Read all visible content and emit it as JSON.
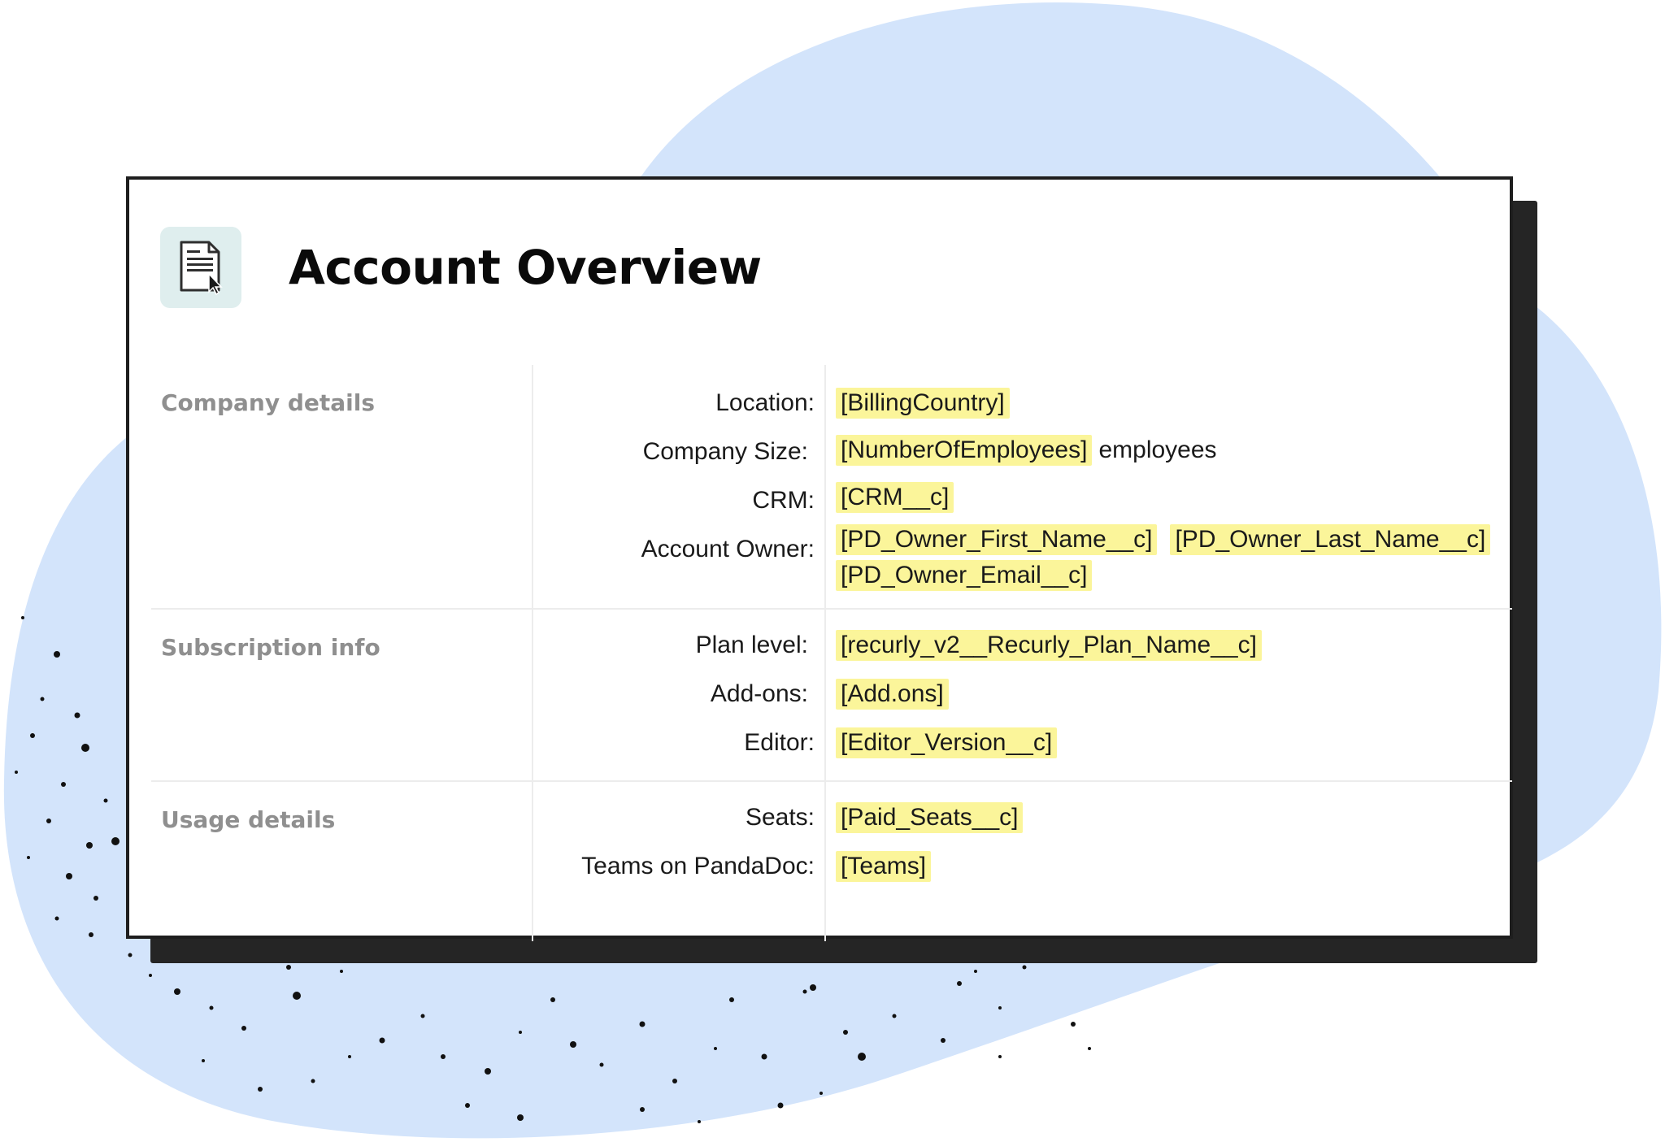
{
  "title": "Account Overview",
  "icon": "document-cursor-icon",
  "colors": {
    "blob": "#d3e4fb",
    "highlight": "#fbf59a",
    "icon_bg": "#dfeeee",
    "section_label": "#8f8f8f"
  },
  "sections": [
    {
      "label": "Company details",
      "rows": [
        {
          "key": "Location:",
          "tags": [
            "[BillingCountry]"
          ]
        },
        {
          "key": "Company Size:",
          "tags": [
            "[NumberOfEmployees]"
          ],
          "suffix": "employees"
        },
        {
          "key": "CRM:",
          "tags": [
            "[CRM__c]"
          ]
        },
        {
          "key": "Account Owner:",
          "tags": [
            "[PD_Owner_First_Name__c]",
            "[PD_Owner_Last_Name__c]"
          ],
          "tags2": [
            "[PD_Owner_Email__c]"
          ]
        }
      ]
    },
    {
      "label": "Subscription info",
      "rows": [
        {
          "key": "Plan level:",
          "tags": [
            "[recurly_v2__Recurly_Plan_Name__c]"
          ]
        },
        {
          "key": "Add-ons:",
          "tags": [
            "[Add.ons]"
          ]
        },
        {
          "key": "Editor:",
          "tags": [
            "[Editor_Version__c]"
          ]
        }
      ]
    },
    {
      "label": "Usage details",
      "rows": [
        {
          "key": "Seats:",
          "tags": [
            "[Paid_Seats__c]"
          ]
        },
        {
          "key": "Teams on PandaDoc:",
          "tags": [
            "[Teams]"
          ]
        }
      ]
    }
  ]
}
